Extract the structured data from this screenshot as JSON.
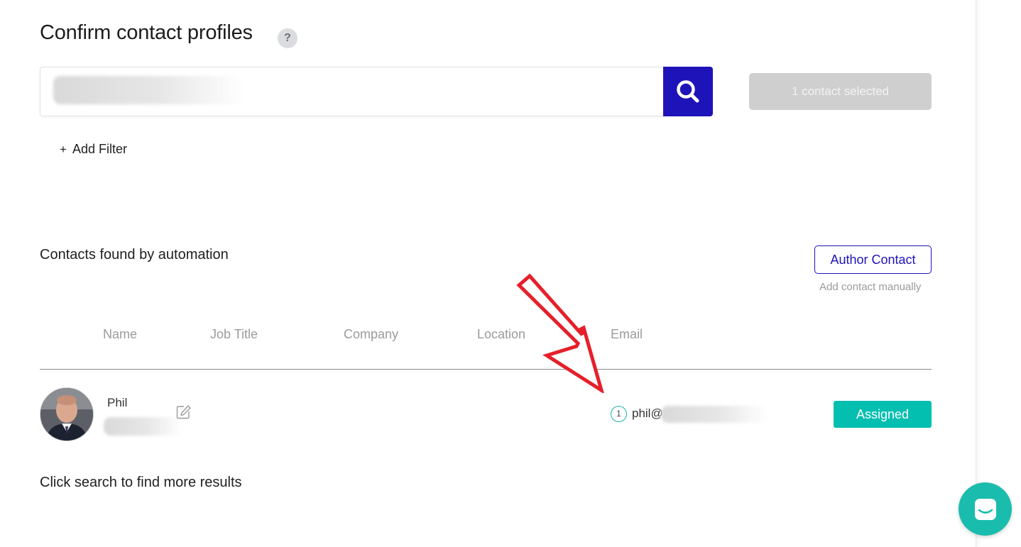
{
  "page": {
    "title": "Confirm contact profiles",
    "help_label": "?"
  },
  "search": {
    "placeholder": "",
    "value_redacted": true,
    "button_icon": "search-icon"
  },
  "selection": {
    "label": "1 contact selected"
  },
  "filters": {
    "add_label": "Add Filter",
    "add_prefix": "+"
  },
  "contacts_section": {
    "heading": "Contacts found by automation",
    "author_button": "Author Contact",
    "author_hint": "Add contact manually",
    "columns": [
      "Name",
      "Job Title",
      "Company",
      "Location",
      "Email"
    ]
  },
  "contacts": [
    {
      "first_name": "Phil",
      "last_name_redacted": true,
      "email_count": "1",
      "email_prefix": "phil@",
      "status": "Assigned"
    }
  ],
  "footer": {
    "more_results": "Click search to find more results"
  },
  "colors": {
    "accent": "#1e13b8",
    "assigned": "#03bfb0",
    "chat": "#1abdad",
    "annotation_arrow": "#e5202a"
  },
  "icons": {
    "help": "question-icon",
    "search": "search-icon",
    "edit": "edit-icon",
    "chat": "chat-icon",
    "annotation": "red-arrow-annotation"
  }
}
